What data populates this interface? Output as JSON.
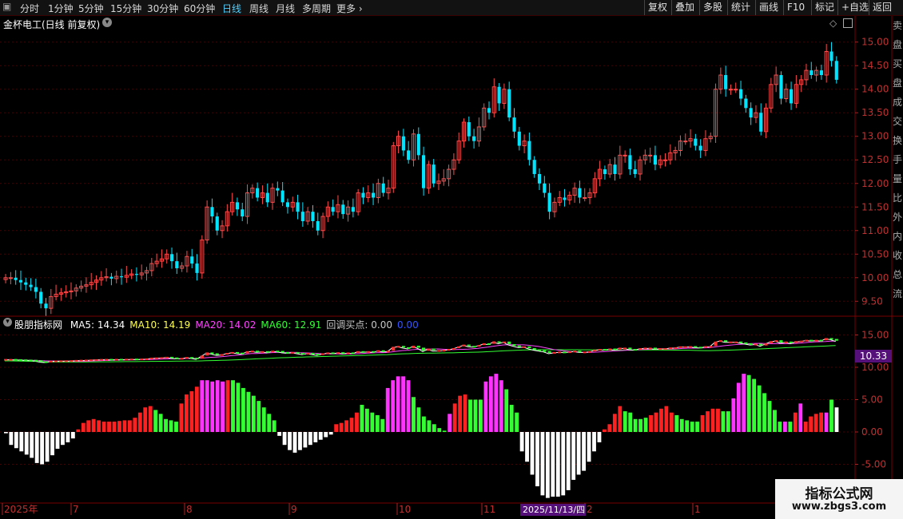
{
  "toolbar": {
    "left_items": [
      {
        "label": "分时",
        "active": false
      },
      {
        "label": "1分钟",
        "active": false
      },
      {
        "label": "5分钟",
        "active": false
      },
      {
        "label": "15分钟",
        "active": false
      },
      {
        "label": "30分钟",
        "active": false
      },
      {
        "label": "60分钟",
        "active": false
      },
      {
        "label": "日线",
        "active": true
      },
      {
        "label": "周线",
        "active": false
      },
      {
        "label": "月线",
        "active": false
      },
      {
        "label": "多周期",
        "active": false
      },
      {
        "label": "更多",
        "active": false
      }
    ],
    "right_items": [
      "复权",
      "叠加",
      "多股",
      "统计",
      "画线",
      "F10",
      "标记",
      "+自选",
      "返回"
    ]
  },
  "chart_title": "金杯电工(日线 前复权)",
  "indicator_header": {
    "name": "股朋指标网",
    "items": [
      {
        "label": "MA5: 14.34",
        "color": "#ffffff"
      },
      {
        "label": "MA10: 14.19",
        "color": "#ffff55"
      },
      {
        "label": "MA20: 14.02",
        "color": "#ff44ff"
      },
      {
        "label": "MA60: 12.91",
        "color": "#33ff33"
      },
      {
        "label": "回调买点: 0.00",
        "color": "#c8c8c8"
      },
      {
        "label": "0.00",
        "color": "#3355ff"
      }
    ]
  },
  "price_axis_labels": [
    "15.00",
    "14.50",
    "14.00",
    "13.50",
    "13.00",
    "12.50",
    "12.00",
    "11.50",
    "11.00",
    "10.50",
    "10.00",
    "9.50"
  ],
  "ind_axis_labels": [
    "15.00",
    "10.00",
    "5.00",
    "0.00",
    "-5.00"
  ],
  "ind_value_tag": "10.33",
  "x_axis_labels": [
    "2025年",
    "7",
    "8",
    "9",
    "10",
    "11",
    "2",
    "1"
  ],
  "x_axis_cursor": "2025/11/13/四",
  "watermark": {
    "line1": "指标公式网",
    "line2": "www.zbgs3.com"
  },
  "colors": {
    "up": "#ff4a4a",
    "down": "#00e5ff",
    "grid": "#5a0000",
    "ma60": "#33ff33"
  },
  "chart_data": [
    {
      "type": "candlestick",
      "title": "金杯电工(日线 前复权)",
      "ylim": [
        9.2,
        15.3
      ],
      "note_values": "approx daily close prices, left to right",
      "close": [
        10.0,
        10.0,
        9.95,
        9.9,
        9.85,
        9.8,
        9.7,
        9.45,
        9.35,
        9.6,
        9.65,
        9.68,
        9.7,
        9.72,
        9.78,
        9.82,
        9.85,
        9.9,
        9.95,
        10.0,
        10.02,
        9.98,
        10.03,
        10.01,
        10.05,
        10.08,
        10.06,
        10.1,
        10.15,
        10.3,
        10.35,
        10.4,
        10.5,
        10.35,
        10.2,
        10.25,
        10.45,
        10.3,
        10.1,
        10.8,
        11.5,
        11.3,
        11.0,
        11.1,
        11.4,
        11.6,
        11.45,
        11.3,
        11.8,
        11.9,
        11.7,
        11.8,
        11.6,
        11.9,
        11.85,
        11.6,
        11.5,
        11.6,
        11.4,
        11.2,
        11.4,
        11.2,
        11.0,
        11.3,
        11.5,
        11.4,
        11.55,
        11.35,
        11.5,
        11.4,
        11.8,
        11.7,
        11.8,
        11.7,
        12.0,
        11.8,
        11.9,
        12.8,
        13.0,
        12.7,
        12.5,
        13.05,
        12.6,
        11.9,
        12.4,
        12.0,
        12.05,
        12.1,
        12.3,
        12.5,
        12.9,
        13.3,
        13.0,
        12.9,
        13.2,
        13.6,
        13.5,
        14.05,
        13.7,
        14.0,
        13.4,
        13.1,
        12.8,
        12.9,
        12.5,
        12.2,
        12.0,
        11.8,
        11.4,
        11.6,
        11.7,
        11.65,
        11.75,
        11.9,
        11.7,
        11.7,
        11.8,
        12.1,
        12.3,
        12.2,
        12.4,
        12.2,
        12.6,
        12.6,
        12.3,
        12.2,
        12.5,
        12.6,
        12.6,
        12.4,
        12.5,
        12.5,
        12.65,
        12.7,
        12.9,
        12.9,
        12.95,
        12.8,
        12.7,
        12.95,
        13.0,
        14.0,
        14.3,
        14.0,
        14.0,
        14.0,
        13.8,
        13.6,
        13.4,
        13.5,
        13.1,
        13.6,
        14.1,
        14.3,
        13.8,
        14.0,
        13.7,
        14.1,
        14.2,
        14.4,
        14.3,
        14.4,
        14.3,
        14.8,
        14.6,
        14.2
      ]
    },
    {
      "type": "bar",
      "title": "股朋指标网",
      "ylim": [
        -7.5,
        16
      ],
      "series": [
        {
          "name": "MA5",
          "value": 14.34
        },
        {
          "name": "MA10",
          "value": 14.19
        },
        {
          "name": "MA20",
          "value": 14.02
        },
        {
          "name": "MA60",
          "value": 12.91
        }
      ],
      "note_values": "histogram values, left to right; colors: white=negative, red=rising, magenta=strong, green=falling",
      "values": [
        -0.2,
        -2.0,
        -2.5,
        -3.0,
        -3.5,
        -4.0,
        -4.8,
        -5.0,
        -4.6,
        -3.6,
        -2.6,
        -2.0,
        -1.6,
        -1.0,
        0.4,
        1.4,
        1.8,
        2.0,
        1.8,
        1.6,
        1.6,
        1.6,
        1.7,
        1.8,
        1.8,
        2.2,
        3.0,
        3.8,
        4.0,
        3.4,
        2.8,
        2.0,
        1.8,
        1.6,
        4.4,
        5.8,
        6.3,
        7.0,
        8.0,
        8.0,
        7.8,
        8.0,
        7.8,
        8.0,
        8.0,
        7.6,
        6.8,
        6.2,
        5.6,
        4.8,
        3.8,
        2.8,
        1.8,
        -0.6,
        -2.0,
        -2.8,
        -3.2,
        -2.8,
        -2.4,
        -2.0,
        -1.6,
        -1.2,
        -0.8,
        -0.4,
        1.2,
        1.4,
        1.8,
        2.2,
        3.0,
        4.2,
        3.6,
        3.0,
        2.6,
        2.0,
        6.8,
        8.0,
        8.6,
        8.6,
        8.0,
        5.4,
        3.8,
        2.4,
        1.8,
        1.2,
        0.6,
        0.2,
        2.8,
        4.4,
        5.6,
        5.8,
        5.0,
        5.0,
        5.0,
        7.8,
        8.6,
        9.0,
        8.0,
        6.6,
        4.2,
        3.0,
        -3.0,
        -4.6,
        -6.6,
        -8.4,
        -9.8,
        -10.2,
        -10.0,
        -10.0,
        -9.8,
        -9.0,
        -7.4,
        -6.6,
        -6.0,
        -4.6,
        -3.0,
        -1.6,
        0.4,
        1.2,
        2.8,
        4.0,
        3.2,
        3.0,
        2.0,
        2.0,
        2.2,
        2.6,
        3.0,
        3.6,
        4.0,
        3.0,
        2.6,
        2.0,
        1.8,
        1.6,
        1.6,
        2.6,
        3.2,
        3.6,
        3.6,
        3.2,
        3.2,
        5.2,
        7.6,
        9.0,
        8.8,
        8.2,
        7.2,
        6.0,
        4.8,
        3.4,
        1.6,
        1.6,
        1.6,
        3.0,
        4.4,
        1.6,
        2.4,
        2.8,
        3.0,
        3.0,
        5.0,
        3.8
      ],
      "colors": [
        "w",
        "w",
        "w",
        "w",
        "w",
        "w",
        "w",
        "w",
        "w",
        "w",
        "w",
        "w",
        "w",
        "w",
        "r",
        "r",
        "r",
        "r",
        "r",
        "r",
        "r",
        "r",
        "r",
        "r",
        "r",
        "r",
        "r",
        "r",
        "r",
        "g",
        "g",
        "g",
        "g",
        "g",
        "r",
        "r",
        "r",
        "r",
        "m",
        "m",
        "m",
        "m",
        "m",
        "r",
        "g",
        "g",
        "g",
        "g",
        "g",
        "g",
        "g",
        "g",
        "g",
        "w",
        "w",
        "w",
        "w",
        "w",
        "w",
        "w",
        "w",
        "w",
        "w",
        "w",
        "r",
        "r",
        "r",
        "r",
        "r",
        "g",
        "g",
        "g",
        "g",
        "g",
        "m",
        "m",
        "m",
        "m",
        "m",
        "g",
        "g",
        "g",
        "g",
        "g",
        "g",
        "g",
        "m",
        "r",
        "r",
        "r",
        "g",
        "g",
        "g",
        "m",
        "m",
        "m",
        "m",
        "g",
        "g",
        "g",
        "w",
        "w",
        "w",
        "w",
        "w",
        "w",
        "w",
        "w",
        "w",
        "w",
        "w",
        "w",
        "w",
        "w",
        "w",
        "w",
        "r",
        "r",
        "r",
        "r",
        "g",
        "g",
        "g",
        "g",
        "g",
        "r",
        "r",
        "r",
        "r",
        "r",
        "g",
        "g",
        "g",
        "g",
        "g",
        "r",
        "r",
        "r",
        "r",
        "g",
        "g",
        "m",
        "m",
        "m",
        "g",
        "g",
        "g",
        "g",
        "g",
        "g",
        "g",
        "m",
        "g",
        "r",
        "m",
        "r",
        "r",
        "r",
        "r",
        "m",
        "g"
      ]
    }
  ]
}
